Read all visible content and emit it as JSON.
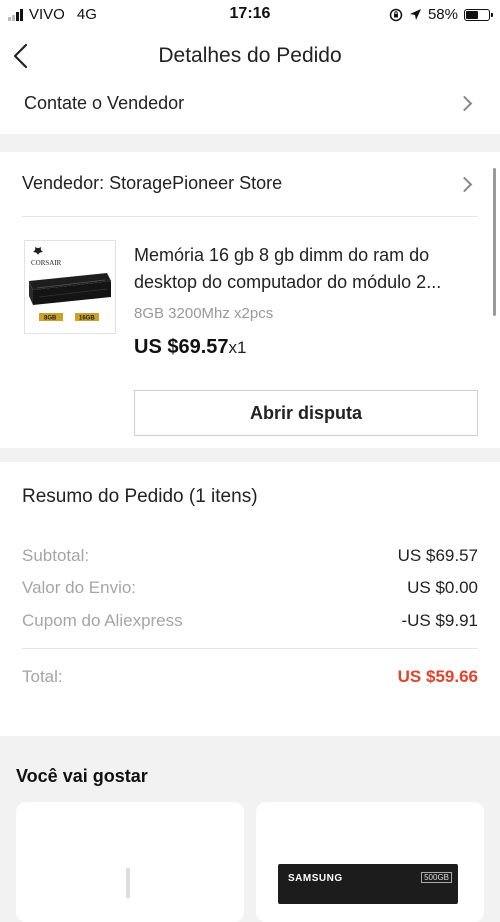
{
  "status_bar": {
    "carrier": "VIVO",
    "network": "4G",
    "time": "17:16",
    "battery": "58%",
    "battery_level": 0.58
  },
  "nav": {
    "title": "Detalhes do Pedido"
  },
  "contact": {
    "label": "Contate o Vendedor"
  },
  "seller": {
    "label": "Vendedor: StoragePioneer Store"
  },
  "product": {
    "thumb_brand": "CORSAIR",
    "thumb_tag1": "8GB",
    "thumb_tag2": "16GB",
    "title_line1": "Memória 16 gb 8 gb dimm do ram do",
    "title_line2": "desktop do computador do módulo 2...",
    "variant": "8GB 3200Mhz x2pcs",
    "price": "US $69.57",
    "quantity": "x1",
    "dispute_button": "Abrir disputa"
  },
  "summary": {
    "title": "Resumo do Pedido (1 itens)",
    "rows": [
      {
        "label": "Subtotal:",
        "value": "US $69.57"
      },
      {
        "label": "Valor do Envio:",
        "value": "US $0.00"
      },
      {
        "label": "Cupom do Aliexpress",
        "value": "-US $9.91"
      }
    ],
    "total_label": "Total:",
    "total_value": "US $59.66",
    "total_color": "#e0442c"
  },
  "recommendations": {
    "title": "Você vai gostar",
    "card2_brand": "SAMSUNG",
    "card2_tag": "500GB"
  }
}
